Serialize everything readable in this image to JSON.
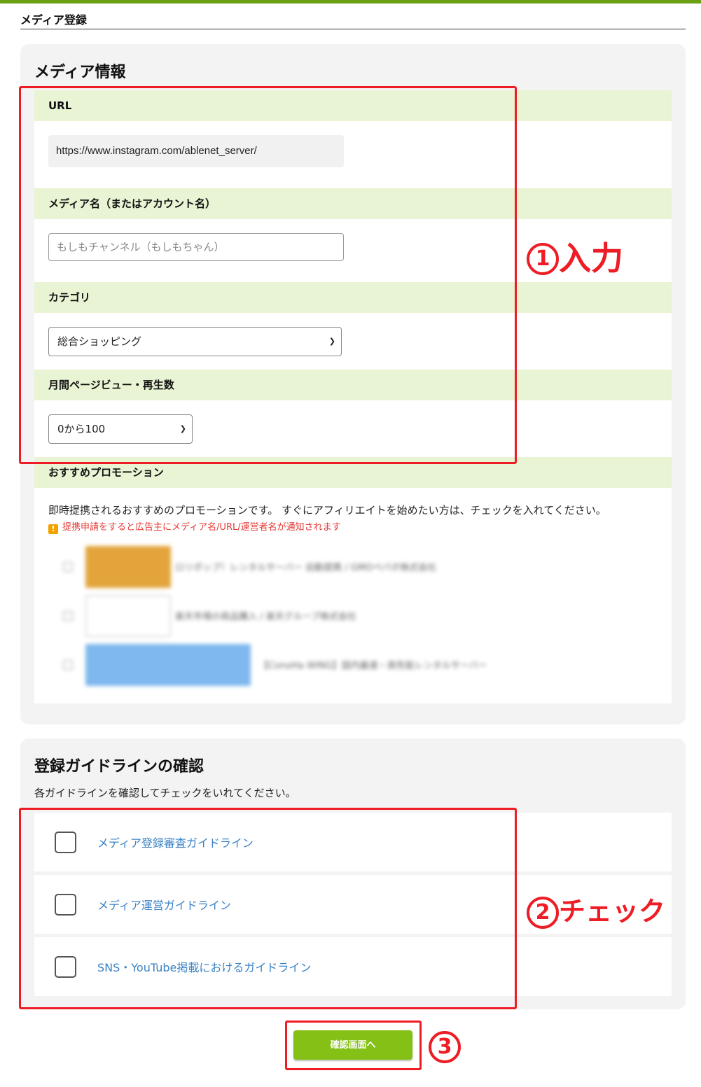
{
  "page": {
    "title": "メディア登録"
  },
  "media_panel": {
    "heading": "メディア情報",
    "url": {
      "label": "URL",
      "value": "https://www.instagram.com/ablenet_server/"
    },
    "media_name": {
      "label": "メディア名（またはアカウント名）",
      "placeholder": "もしもチャンネル（もしもちゃん）"
    },
    "category": {
      "label": "カテゴリ",
      "selected": "総合ショッピング"
    },
    "monthly_views": {
      "label": "月間ページビュー・再生数",
      "selected": "0から100"
    },
    "promotion": {
      "label": "おすすめプロモーション",
      "description": "即時提携されるおすすめのプロモーションです。 すぐにアフィリエイトを始めたい方は、チェックを入れてください。",
      "warning": "提携申請をすると広告主にメディア名/URL/運営者名が通知されます",
      "items": [
        {
          "text": "ロリポップ！レンタルサーバー 自動提携 / GMOペパボ株式会社",
          "banner_color": "#e3a43c"
        },
        {
          "text": "楽天市場の商品購入 / 楽天グループ株式会社",
          "banner_color": "#ffffff"
        },
        {
          "text": "【ConoHa WING】国内最速・高性能レンタルサーバー",
          "banner_color": "#7fb8ee"
        }
      ]
    }
  },
  "guide_panel": {
    "heading": "登録ガイドラインの確認",
    "subtitle": "各ガイドラインを確認してチェックをいれてください。",
    "items": [
      {
        "label": "メディア登録審査ガイドライン"
      },
      {
        "label": "メディア運営ガイドライン"
      },
      {
        "label": "SNS・YouTube掲載におけるガイドライン"
      }
    ]
  },
  "confirm_button": {
    "label": "確認画面へ"
  },
  "annotations": {
    "step1": {
      "number": "1",
      "text": "入力"
    },
    "step2": {
      "number": "2",
      "text": "チェック"
    },
    "step3": {
      "number": "3"
    }
  },
  "colors": {
    "accent": "#84c015",
    "header_green": "#e8f4d3",
    "annotation_red": "#ee1c25",
    "link": "#3b82c4"
  }
}
